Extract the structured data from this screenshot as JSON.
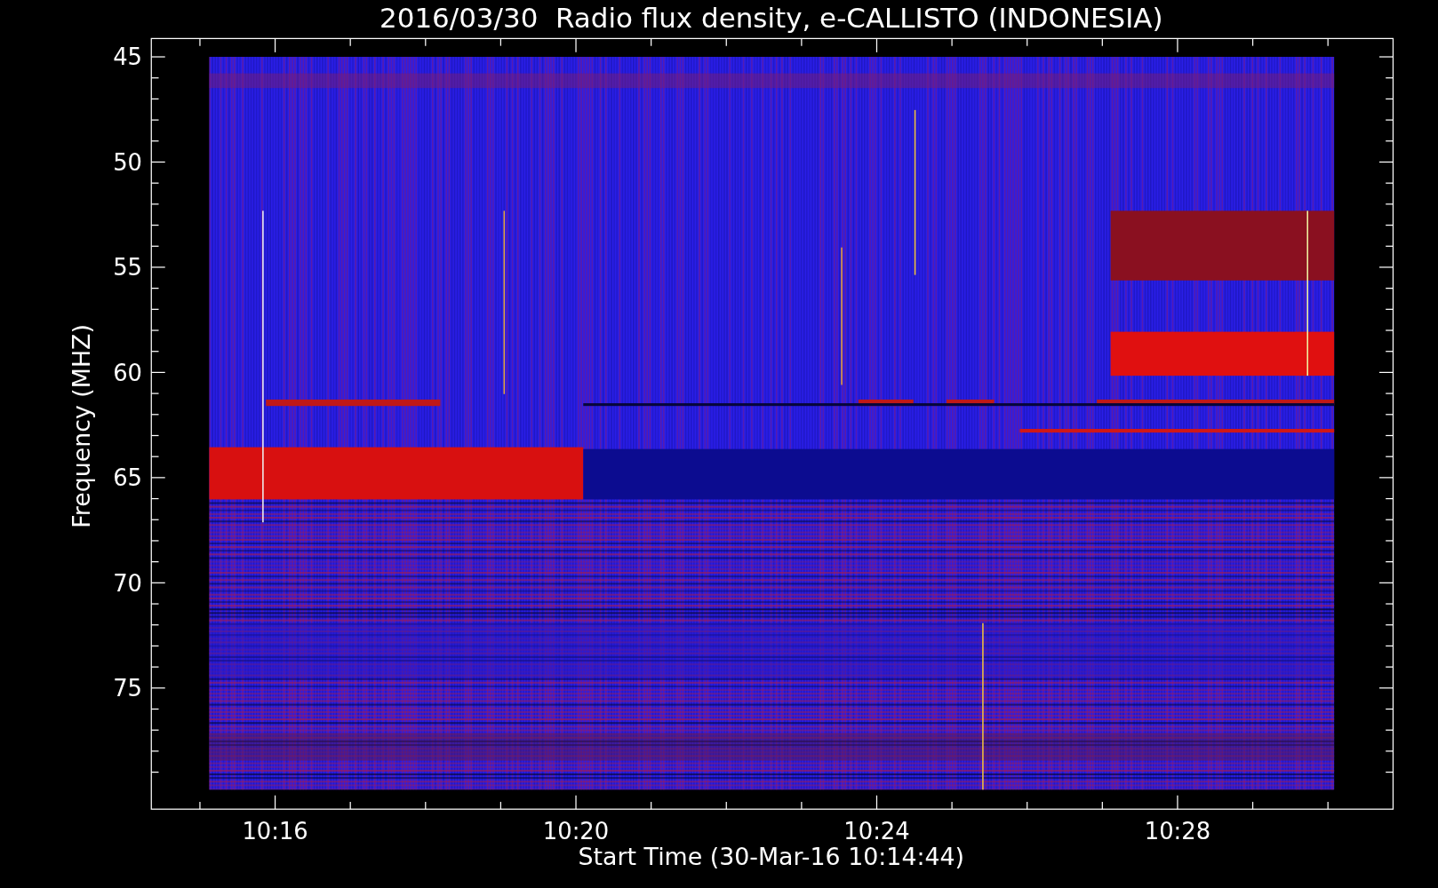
{
  "title": "2016/03/30  Radio flux density, e-CALLISTO (INDONESIA)",
  "y_axis": {
    "label": "Frequency (MHZ)",
    "ticks": [
      "45",
      "50",
      "55",
      "60",
      "65",
      "70",
      "75"
    ]
  },
  "x_axis": {
    "label": "Start Time (30-Mar-16 10:14:44)",
    "ticks": [
      "10:16",
      "10:20",
      "10:24",
      "10:28"
    ]
  }
}
